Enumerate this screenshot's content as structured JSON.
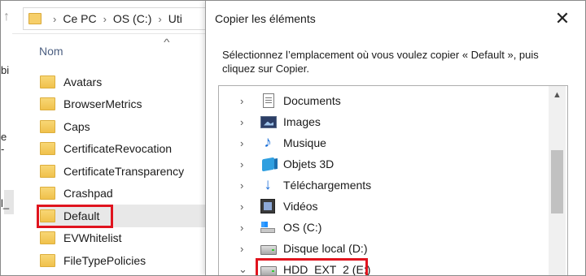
{
  "explorer": {
    "breadcrumb": [
      "Ce PC",
      "OS (C:)",
      "Uti"
    ],
    "column_header": "Nom",
    "left_edge_fragments": [
      "bi",
      "e -",
      "l_"
    ],
    "files": [
      {
        "label": "Avatars"
      },
      {
        "label": "BrowserMetrics"
      },
      {
        "label": "Caps"
      },
      {
        "label": "CertificateRevocation"
      },
      {
        "label": "CertificateTransparency"
      },
      {
        "label": "Crashpad"
      },
      {
        "label": "Default",
        "selected": true
      },
      {
        "label": "EVWhitelist"
      },
      {
        "label": "FileTypePolicies"
      }
    ]
  },
  "dialog": {
    "title": "Copier les éléments",
    "close_glyph": "✕",
    "message": "Sélectionnez l’emplacement où vous voulez copier « Default », puis cliquez sur Copier.",
    "tree": [
      {
        "label": "Documents",
        "icon": "documents-icon",
        "expanded": false
      },
      {
        "label": "Images",
        "icon": "images-icon",
        "expanded": false
      },
      {
        "label": "Musique",
        "icon": "music-icon",
        "expanded": false
      },
      {
        "label": "Objets 3D",
        "icon": "objects-3d-icon",
        "expanded": false
      },
      {
        "label": "Téléchargements",
        "icon": "downloads-icon",
        "expanded": false
      },
      {
        "label": "Vidéos",
        "icon": "videos-icon",
        "expanded": false
      },
      {
        "label": "OS (C:)",
        "icon": "os-drive-icon",
        "expanded": false
      },
      {
        "label": "Disque local (D:)",
        "icon": "drive-icon",
        "expanded": false
      },
      {
        "label": "HDD_EXT_2 (E:)",
        "icon": "drive-icon",
        "expanded": true,
        "highlighted": true
      }
    ]
  },
  "colors": {
    "highlight": "#e0141e",
    "folder": "#f0c14b"
  }
}
